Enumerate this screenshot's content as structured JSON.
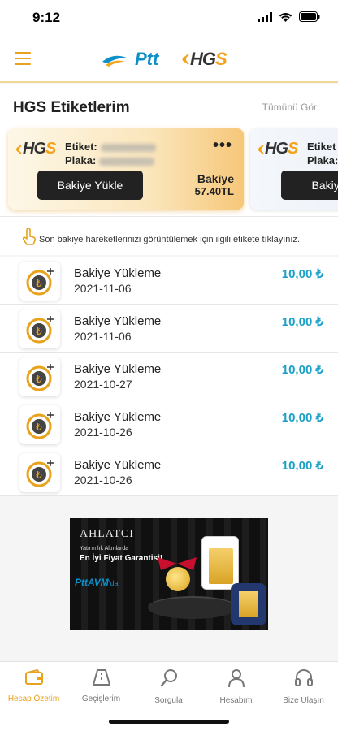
{
  "status_bar": {
    "time": "9:12"
  },
  "header": {
    "ptt_logo_text": "Ptt",
    "hgs_logo_text": "HGS",
    "menu_icon": "hamburger-menu-icon"
  },
  "section": {
    "title": "HGS Etiketlerim",
    "see_all": "Tümünü Gör"
  },
  "cards": [
    {
      "logo": "HGS",
      "etiket_label": "Etiket:",
      "plaka_label": "Plaka:",
      "button": "Bakiye Yükle",
      "balance_label": "Bakiye",
      "balance_value": "57.40TL",
      "more": "•••"
    },
    {
      "logo": "HGS",
      "etiket_label": "Etiket",
      "plaka_label": "Plaka:",
      "button": "Bakiye Y"
    }
  ],
  "hint": {
    "text": "Son bakiye hareketlerinizi görüntülemek için ilgili etikete tıklayınız."
  },
  "transactions": [
    {
      "title": "Bakiye Yükleme",
      "date": "2021-11-06",
      "amount": "10,00 ₺"
    },
    {
      "title": "Bakiye Yükleme",
      "date": "2021-11-06",
      "amount": "10,00 ₺"
    },
    {
      "title": "Bakiye Yükleme",
      "date": "2021-10-27",
      "amount": "10,00 ₺"
    },
    {
      "title": "Bakiye Yükleme",
      "date": "2021-10-26",
      "amount": "10,00 ₺"
    },
    {
      "title": "Bakiye Yükleme",
      "date": "2021-10-26",
      "amount": "10,00 ₺"
    }
  ],
  "banner": {
    "brand": "AHLATCI",
    "subtitle": "Yatırımlık Altınlarda",
    "headline": "En İyi Fiyat Garantisi!",
    "ptt_avm": "PttAVM",
    "suffix": "'da"
  },
  "tabbar": [
    {
      "label": "Hesap Özetim",
      "icon": "wallet-icon",
      "active": true
    },
    {
      "label": "Geçişlerim",
      "icon": "road-icon",
      "active": false
    },
    {
      "label": "Sorgula",
      "icon": "search-icon",
      "active": false
    },
    {
      "label": "Hesabım",
      "icon": "user-icon",
      "active": false
    },
    {
      "label": "Bize Ulaşın",
      "icon": "headset-icon",
      "active": false
    }
  ],
  "colors": {
    "accent": "#e8a21c",
    "amount": "#1ba1c8",
    "button": "#222222"
  }
}
